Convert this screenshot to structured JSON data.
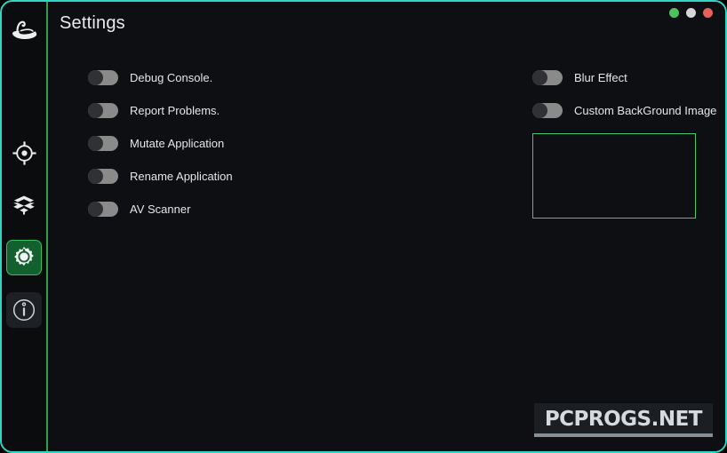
{
  "window": {
    "title": "Settings",
    "border_color": "#2fd6c8",
    "background": "#0d0f12",
    "controls": [
      {
        "name": "minimize",
        "color": "#4cc45e"
      },
      {
        "name": "maximize",
        "color": "#d6d6d6"
      },
      {
        "name": "close",
        "color": "#e8605a"
      }
    ]
  },
  "sidebar": {
    "accent_color": "#2e9e4f",
    "active_bg": "#13602f",
    "logo": {
      "icon": "fedora-hat-icon",
      "label": "App Logo"
    },
    "items": [
      {
        "id": "target",
        "icon": "crosshair-target-icon",
        "label": "Target",
        "state": "plain"
      },
      {
        "id": "packages",
        "icon": "open-box-icon",
        "label": "Packages",
        "state": "plain"
      },
      {
        "id": "settings",
        "icon": "gear-icon",
        "label": "Settings",
        "state": "active"
      },
      {
        "id": "about",
        "icon": "info-circle-icon",
        "label": "About",
        "state": "hovered"
      }
    ]
  },
  "main": {
    "left_column": [
      {
        "id": "debug-console",
        "label": "Debug Console.",
        "enabled": false
      },
      {
        "id": "report-problems",
        "label": "Report Problems.",
        "enabled": false
      },
      {
        "id": "mutate-application",
        "label": "Mutate Application",
        "enabled": false
      },
      {
        "id": "rename-application",
        "label": "Rename Application",
        "enabled": false
      },
      {
        "id": "av-scanner",
        "label": "AV Scanner",
        "enabled": false
      }
    ],
    "right_column": [
      {
        "id": "blur-effect",
        "label": "Blur Effect",
        "enabled": false
      },
      {
        "id": "custom-background-image",
        "label": "Custom BackGround Image",
        "enabled": false
      }
    ],
    "background_preview": {
      "border_color": "#46c46e",
      "content": ""
    }
  },
  "watermark": {
    "text": "PCPROGS.NET"
  }
}
